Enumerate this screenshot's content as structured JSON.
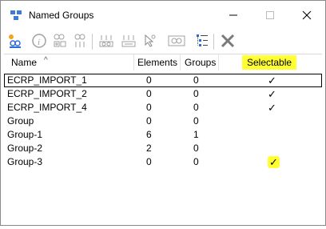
{
  "window": {
    "title": "Named Groups"
  },
  "columns": {
    "name": "Name",
    "elements": "Elements",
    "groups": "Groups",
    "selectable": "Selectable"
  },
  "rows": [
    {
      "name": "ECRP_IMPORT_1",
      "elements": "0",
      "groups": "0",
      "selectable": "✓"
    },
    {
      "name": "ECRP_IMPORT_2",
      "elements": "0",
      "groups": "0",
      "selectable": "✓"
    },
    {
      "name": "ECRP_IMPORT_4",
      "elements": "0",
      "groups": "0",
      "selectable": "✓"
    },
    {
      "name": "Group",
      "elements": "0",
      "groups": "0",
      "selectable": ""
    },
    {
      "name": "Group-1",
      "elements": "6",
      "groups": "1",
      "selectable": ""
    },
    {
      "name": "Group-2",
      "elements": "2",
      "groups": "0",
      "selectable": ""
    },
    {
      "name": "Group-3",
      "elements": "0",
      "groups": "0",
      "selectable": "✓"
    }
  ],
  "icons": {
    "toolbar": [
      "new-group-icon",
      "info-icon",
      "add-elements-icon",
      "remove-elements-icon",
      "select-elements-icon",
      "deselect-elements-icon",
      "select-tool-icon",
      "display-icon",
      "properties-list-icon",
      "delete-icon"
    ]
  },
  "colors": {
    "highlight": "#ffff33",
    "delete": "#7a7a7a"
  }
}
